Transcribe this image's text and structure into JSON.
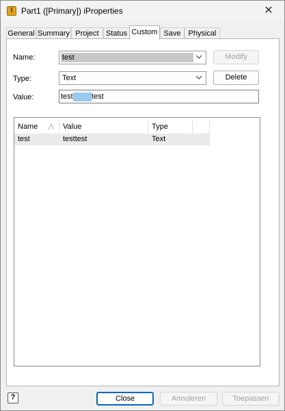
{
  "window": {
    "title": "Part1 ([Primary]) iProperties",
    "app_icon_letter": "I",
    "close_glyph": "✕"
  },
  "tabs": [
    {
      "label": "General"
    },
    {
      "label": "Summary"
    },
    {
      "label": "Project"
    },
    {
      "label": "Status"
    },
    {
      "label": "Custom"
    },
    {
      "label": "Save"
    },
    {
      "label": "Physical"
    }
  ],
  "active_tab": "Custom",
  "form": {
    "name_label": "Name:",
    "name_value": "test",
    "type_label": "Type:",
    "type_value": "Text",
    "value_label": "Value:",
    "value_text_before": "test",
    "value_text_after": "test",
    "modify_button": "Modify",
    "delete_button": "Delete"
  },
  "table": {
    "columns": [
      "Name",
      "Value",
      "Type"
    ],
    "rows": [
      {
        "name": "test",
        "value": "testtest",
        "type": "Text"
      }
    ]
  },
  "footer": {
    "help_glyph": "?",
    "close_button": "Close",
    "cancel_button": "Annuleren",
    "apply_button": "Toepassen"
  },
  "colors": {
    "accent": "#0067c0",
    "selection_highlight": "#99c9ef",
    "row_highlight": "#eaeaea"
  }
}
